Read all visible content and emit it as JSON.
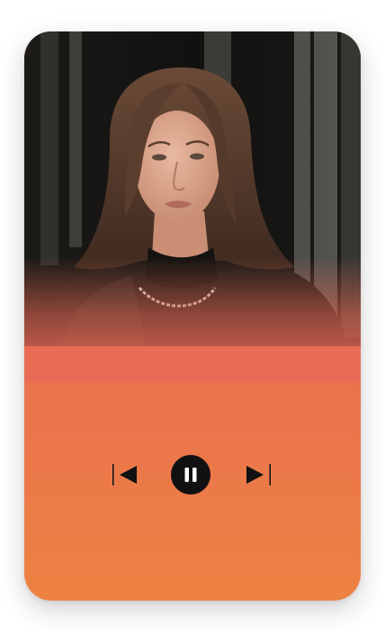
{
  "player": {
    "cover": {
      "subject": "portrait-photo",
      "colors": {
        "background_dark": "#151311",
        "hair": "#5a3a2a",
        "skin": "#d9a48c",
        "jacket": "#1b1917"
      }
    },
    "gradient": {
      "top": "#e96a55",
      "bottom": "#ed8242"
    },
    "state": "playing",
    "controls": {
      "previous_icon": "skip-previous-icon",
      "pause_icon": "pause-icon",
      "next_icon": "skip-next-icon"
    }
  }
}
